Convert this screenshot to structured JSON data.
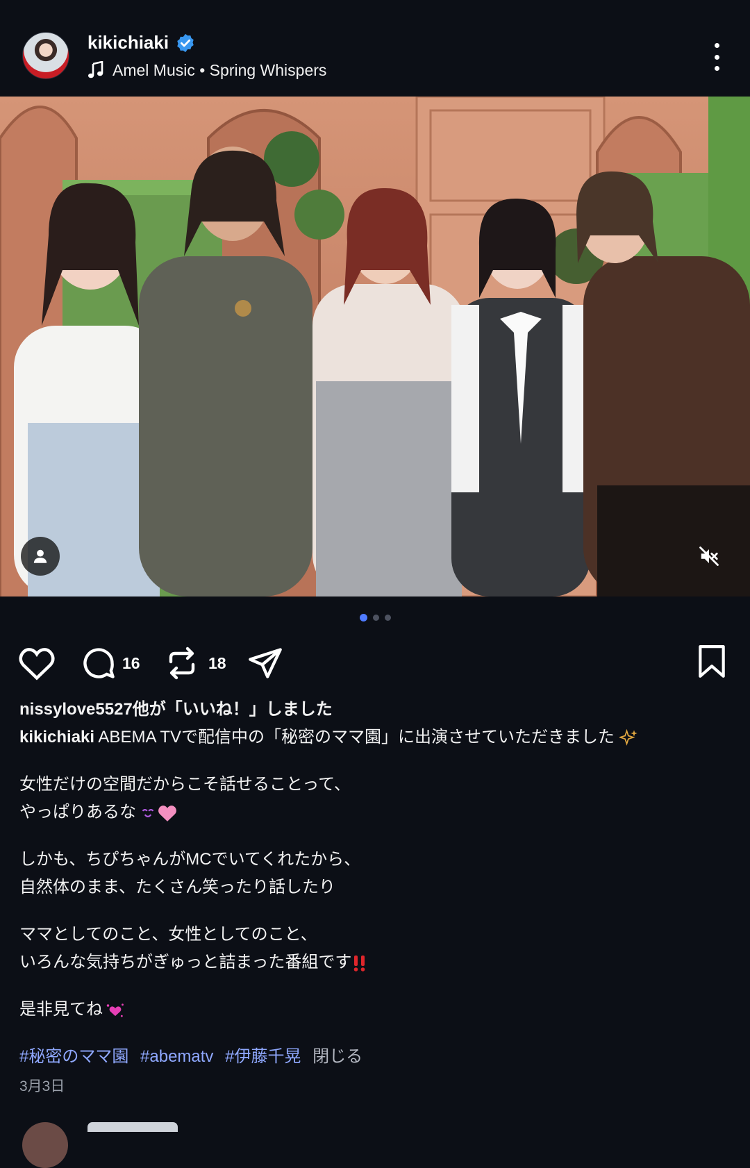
{
  "header": {
    "username": "kikichiaki",
    "verified": true,
    "music_label": "Amel Music • Spring Whispers",
    "icons": [
      "avatar",
      "verified-badge-icon",
      "music-note-icon",
      "more-vertical-icon"
    ]
  },
  "photo": {
    "alt": "",
    "carousel": {
      "current": 1,
      "total": 3
    },
    "icons": [
      "user-tag-icon",
      "mute-icon"
    ]
  },
  "actions": {
    "like_icon": "heart-outline-icon",
    "comment_icon": "comment-bubble-icon",
    "comment_count": "16",
    "repost_icon": "repost-icon",
    "repost_count": "18",
    "share_icon": "send-icon",
    "save_icon": "bookmark-outline-icon"
  },
  "caption": {
    "likes_text": "nissylove5527他が「いいね！」しました",
    "author": "kikichiaki",
    "line1": "ABEMA TVで配信中の「秘密のママ園」に出演させていただきました",
    "para2": "女性だけの空間だからこそ話せることって、\nやっぱりあるな",
    "para3": "しかも、ちぴちゃんがMCでいてくれたから、\n自然体のまま、たくさん笑ったり話したり",
    "para4": "ママとしてのこと、女性としてのこと、\nいろんな気持ちがぎゅっと詰まった番組です",
    "para5": "是非見てね",
    "hashtags": [
      "#秘密のママ園",
      "#abematv",
      "#伊藤千晃"
    ],
    "close_label": "閉じる",
    "emoji": [
      "sparkles-icon",
      "smiling-face-icon",
      "pink-heart-icon",
      "double-exclamation-icon",
      "heart-sparkle-icon"
    ]
  },
  "date": "3月3日",
  "colors": {
    "background": "#0c0f16",
    "hashtag": "#8fa8ff",
    "verified": "#3897f0",
    "carousel_active": "#4f7bff"
  }
}
